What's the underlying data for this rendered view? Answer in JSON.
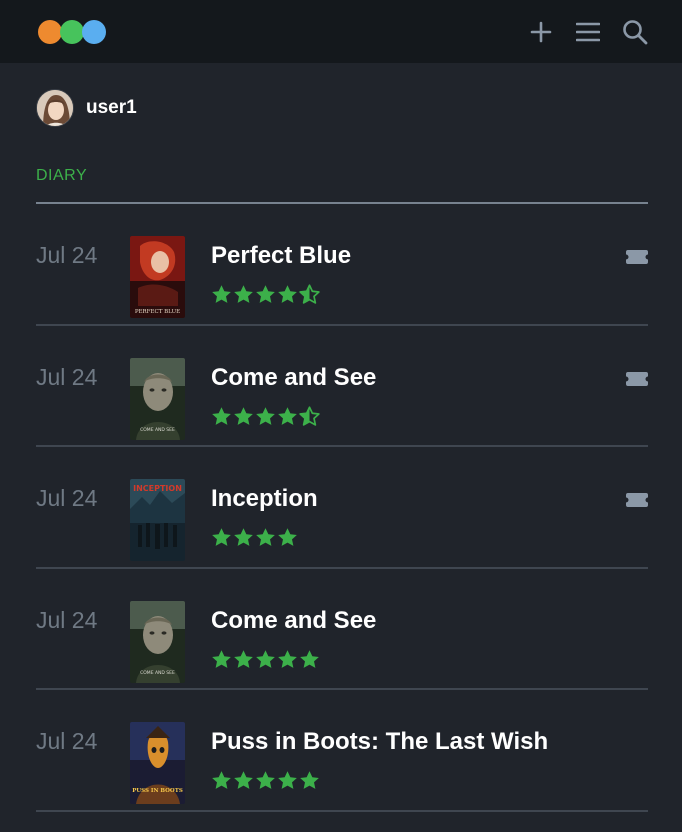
{
  "app": {
    "logo_colors": [
      "#ee8a2f",
      "#47c35c",
      "#5aaef0"
    ]
  },
  "nav": {
    "icons": [
      "plus-icon",
      "menu-icon",
      "search-icon"
    ]
  },
  "profile": {
    "username": "user1"
  },
  "section": {
    "title": "DIARY",
    "accent": "#3cb04a"
  },
  "entries": [
    {
      "date": "Jul 24",
      "title": "Perfect Blue",
      "stars": 4.5,
      "rewatch": true,
      "poster_caption": "PERFECT BLUE"
    },
    {
      "date": "Jul 24",
      "title": "Come and See",
      "stars": 4.5,
      "rewatch": true,
      "poster_caption": "COME AND SEE"
    },
    {
      "date": "Jul 24",
      "title": "Inception",
      "stars": 4,
      "rewatch": true,
      "poster_caption": "INCEPTION"
    },
    {
      "date": "Jul 24",
      "title": "Come and See",
      "stars": 5,
      "rewatch": false,
      "poster_caption": "COME AND SEE"
    },
    {
      "date": "Jul 24",
      "title": "Puss in Boots: The Last Wish",
      "stars": 5,
      "rewatch": false,
      "poster_caption": "PUSS IN BOOTS"
    }
  ],
  "colors": {
    "star": "#3cb04a",
    "icon": "#8b98a7"
  }
}
